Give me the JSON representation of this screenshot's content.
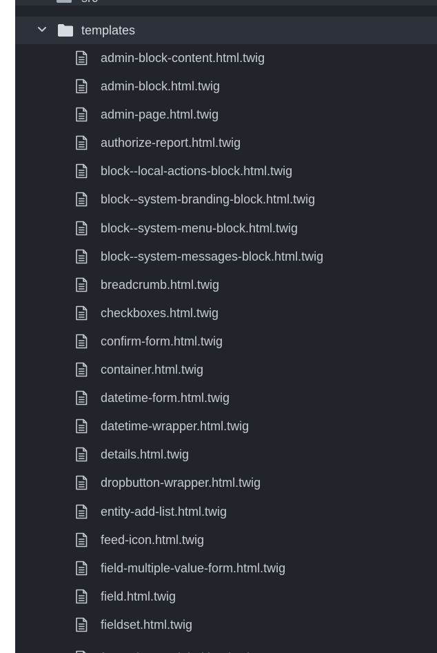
{
  "tree": {
    "partial_folder": {
      "name": "src",
      "icon": "folder-icon",
      "state": "collapsed"
    },
    "folder": {
      "name": "templates",
      "icon": "folder-icon",
      "state": "expanded"
    },
    "files": [
      "admin-block-content.html.twig",
      "admin-block.html.twig",
      "admin-page.html.twig",
      "authorize-report.html.twig",
      "block--local-actions-block.html.twig",
      "block--system-branding-block.html.twig",
      "block--system-menu-block.html.twig",
      "block--system-messages-block.html.twig",
      "breadcrumb.html.twig",
      "checkboxes.html.twig",
      "confirm-form.html.twig",
      "container.html.twig",
      "datetime-form.html.twig",
      "datetime-wrapper.html.twig",
      "details.html.twig",
      "dropbutton-wrapper.html.twig",
      "entity-add-list.html.twig",
      "feed-icon.html.twig",
      "field-multiple-value-form.html.twig",
      "field.html.twig",
      "fieldset.html.twig",
      "form-element-label.html.twig"
    ],
    "file_icon": "file-text-icon"
  },
  "colors": {
    "panel_bg": "#21252b",
    "selected_row_bg": "#2c313a",
    "text": "#c5c9d1"
  }
}
